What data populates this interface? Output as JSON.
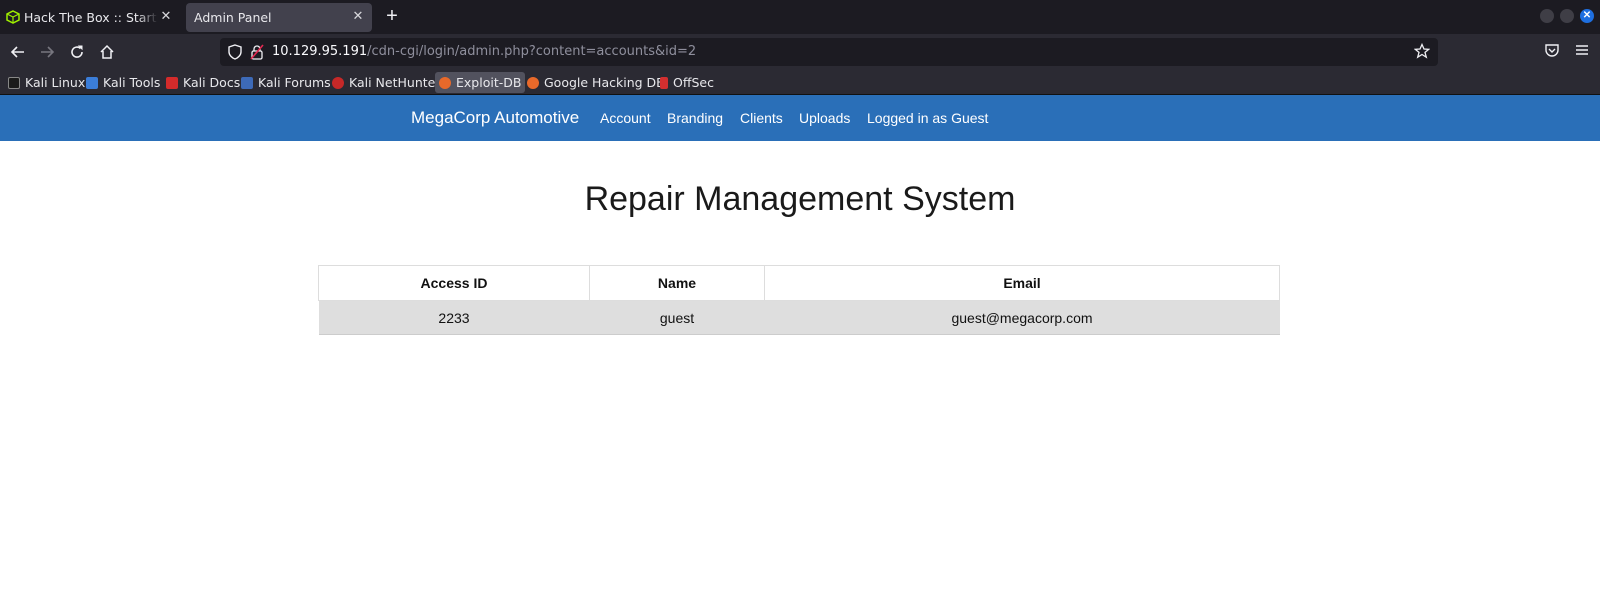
{
  "browser": {
    "tabs": [
      {
        "title": "Hack The Box :: Starting P"
      },
      {
        "title": "Admin Panel"
      }
    ],
    "url_host": "10.129.95.191",
    "url_path": "/cdn-cgi/login/admin.php?content=accounts&id=2",
    "bookmarks": [
      {
        "label": "Kali Linux"
      },
      {
        "label": "Kali Tools"
      },
      {
        "label": "Kali Docs"
      },
      {
        "label": "Kali Forums"
      },
      {
        "label": "Kali NetHunter"
      },
      {
        "label": "Exploit-DB"
      },
      {
        "label": "Google Hacking DB"
      },
      {
        "label": "OffSec"
      }
    ]
  },
  "site": {
    "brand": "MegaCorp Automotive",
    "nav": [
      {
        "label": "Account"
      },
      {
        "label": "Branding"
      },
      {
        "label": "Clients"
      },
      {
        "label": "Uploads"
      },
      {
        "label": "Logged in as Guest"
      }
    ],
    "heading": "Repair Management System",
    "table": {
      "headers": [
        "Access ID",
        "Name",
        "Email"
      ],
      "rows": [
        [
          "2233",
          "guest",
          "guest@megacorp.com"
        ]
      ]
    },
    "colors": {
      "navbar": "#2a6fb8",
      "row_bg": "#dedede"
    }
  }
}
